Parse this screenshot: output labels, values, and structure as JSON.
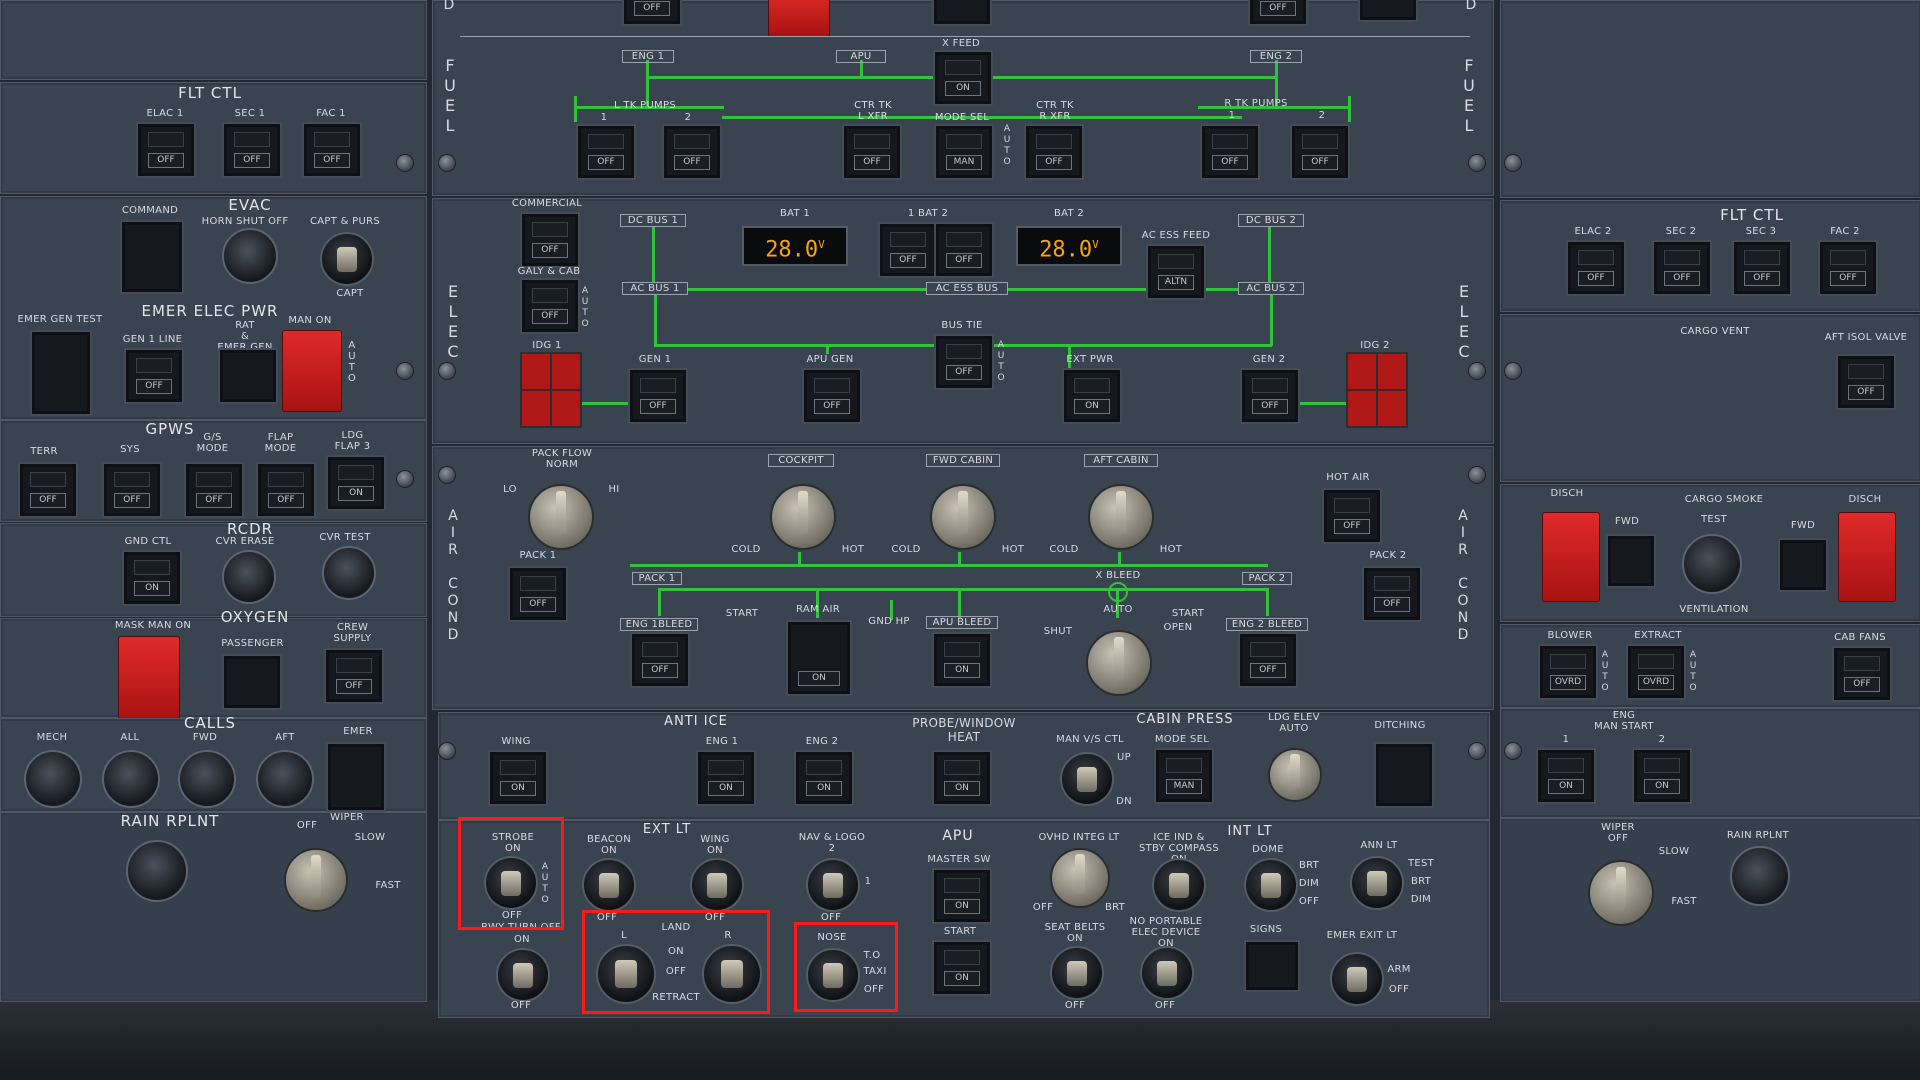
{
  "fuel": {
    "side_left": "FUEL",
    "side_right": "FUEL",
    "top_letter_left": "D",
    "top_letter_right": "D",
    "eng1": "ENG 1",
    "apu": "APU",
    "xfeed": "X FEED",
    "xfeed_ind": "ON",
    "eng2": "ENG 2",
    "l_tk_pumps": "L  TK  PUMPS",
    "r_tk_pumps": "R  TK  PUMPS",
    "ctr_tk_l": "CTR TK\nL XFR",
    "ctr_tk_r": "CTR TK\nR XFR",
    "mode_sel": "MODE SEL",
    "mode_ind": "MAN",
    "auto_vert": "AUTO",
    "off": "OFF",
    "n1": "1",
    "n2": "2"
  },
  "flt_ctl_left": {
    "title": "FLT CTL",
    "elac1": "ELAC 1",
    "sec1": "SEC 1",
    "fac1": "FAC 1"
  },
  "flt_ctl_right": {
    "title": "FLT  CTL",
    "elac2": "ELAC 2",
    "sec2": "SEC 2",
    "sec3": "SEC 3",
    "fac2": "FAC 2"
  },
  "evac": {
    "title": "EVAC",
    "command": "COMMAND",
    "horn": "HORN SHUT OFF",
    "capt_purs": "CAPT & PURS",
    "capt": "CAPT"
  },
  "emer_elec": {
    "title": "EMER ELEC PWR",
    "gen_test": "EMER GEN TEST",
    "gen1_line": "GEN 1 LINE",
    "rat": "RAT\n&\nEMER GEN",
    "man_on": "MAN ON",
    "auto": "AUTO"
  },
  "gpws": {
    "title": "GPWS",
    "terr": "TERR",
    "sys": "SYS",
    "gs_mode": "G/S\nMODE",
    "flap_mode": "FLAP\nMODE",
    "ldg_flap3": "LDG\nFLAP 3",
    "on": "ON"
  },
  "rcdr": {
    "title": "RCDR",
    "gnd_ctl": "GND CTL",
    "cvr_erase": "CVR ERASE",
    "cvr_test": "CVR TEST"
  },
  "oxygen": {
    "title": "OXYGEN",
    "mask": "MASK MAN ON",
    "passenger": "PASSENGER",
    "crew": "CREW\nSUPPLY"
  },
  "calls": {
    "title": "CALLS",
    "mech": "MECH",
    "all": "ALL",
    "fwd": "FWD",
    "aft": "AFT",
    "emer": "EMER"
  },
  "rain_left": {
    "title": "RAIN RPLNT",
    "wiper": "WIPER",
    "off": "OFF",
    "slow": "SLOW",
    "fast": "FAST"
  },
  "elec": {
    "side": "ELEC",
    "commercial": "COMMERCIAL",
    "galy": "GALY & CAB",
    "dc_bus1": "DC BUS 1",
    "dc_bus2": "DC BUS 2",
    "ac_bus1": "AC BUS 1",
    "ac_bus2": "AC BUS 2",
    "ac_ess_bus": "AC ESS BUS",
    "ac_ess_feed": "AC ESS FEED",
    "altn": "ALTN",
    "bat1": "BAT 1",
    "bat2": "BAT 2",
    "bat_center": "1   BAT   2",
    "bat1_val": "28.0",
    "bat2_val": "28.0",
    "volt_unit": "V",
    "idg1": "IDG 1",
    "idg2": "IDG 2",
    "gen1": "GEN 1",
    "gen2": "GEN 2",
    "apu_gen": "APU GEN",
    "bus_tie": "BUS TIE",
    "ext_pwr": "EXT PWR",
    "on": "ON"
  },
  "air_cond": {
    "side": "AIR COND",
    "pack_flow": "PACK FLOW\nNORM",
    "lo": "LO",
    "hi": "HI",
    "cockpit": "COCKPIT",
    "fwd_cabin": "FWD CABIN",
    "aft_cabin": "AFT  CABIN",
    "cold": "COLD",
    "hot": "HOT",
    "hot_air": "HOT AIR",
    "pack1": "PACK 1",
    "pack2": "PACK 2",
    "x_bleed": "X BLEED",
    "auto": "AUTO",
    "shut": "SHUT",
    "open": "OPEN",
    "start": "START",
    "ram_air": "RAM AIR",
    "gnd_hp": "GND HP",
    "apu_bleed": "APU  BLEED",
    "eng1_bleed": "ENG 1BLEED",
    "eng2_bleed": "ENG 2 BLEED"
  },
  "anti_ice": {
    "title": "ANTI ICE",
    "wing": "WING",
    "eng1": "ENG 1",
    "eng2": "ENG 2",
    "probe": "PROBE/WINDOW\nHEAT"
  },
  "cabin_press": {
    "title": "CABIN PRESS",
    "man_vs": "MAN V/S CTL",
    "up": "UP",
    "dn": "DN",
    "mode_sel": "MODE SEL",
    "man": "MAN",
    "ldg_elev": "LDG ELEV\nAUTO",
    "ditching": "DITCHING"
  },
  "ext_lt": {
    "title": "EXT LT",
    "strobe": "STROBE\nON",
    "beacon": "BEACON\nON",
    "wing": "WING\nON",
    "nav_logo": "NAV & LOGO\n2",
    "one": "1",
    "off": "OFF",
    "rwy_turn_off": "RWY TURN OFF",
    "on": "ON",
    "land": "LAND",
    "land_l": "L",
    "land_r": "R",
    "retract": "RETRACT",
    "nose": "NOSE",
    "to": "T.O",
    "taxi": "TAXI"
  },
  "apu_panel": {
    "title": "APU",
    "master": "MASTER SW",
    "start": "START",
    "on": "ON"
  },
  "int_lt": {
    "title": "INT LT",
    "ovhd": "OVHD INTEG LT",
    "off": "OFF",
    "brt": "BRT",
    "ice_ind": "ICE IND &\nSTBY COMPASS\nON",
    "dome": "DOME",
    "dim": "DIM",
    "ann_lt": "ANN LT",
    "test": "TEST",
    "seat_belts": "SEAT BELTS\nON",
    "no_portable": "NO PORTABLE\nELEC DEVICE\nON",
    "signs": "SIGNS",
    "emer_exit": "EMER EXIT LT",
    "arm": "ARM"
  },
  "right_panels": {
    "cargo_vent": "CARGO  VENT",
    "aft_isol": "AFT ISOL VALVE",
    "cargo_smoke": "CARGO  SMOKE",
    "disch": "DISCH",
    "fwd": "FWD",
    "test": "TEST",
    "ventilation": "VENTILATION",
    "blower": "BLOWER",
    "extract": "EXTRACT",
    "ovrd": "OVRD",
    "cab_fans": "CAB FANS",
    "eng_man_start": "ENG\nMAN START",
    "n1": "1",
    "n2": "2",
    "wiper": "WIPER\nOFF",
    "slow": "SLOW",
    "fast": "FAST",
    "rain": "RAIN RPLNT"
  },
  "colors": {
    "panel": "#3a4350",
    "green_line": "#33c23b",
    "guard_red": "#c81e1e",
    "highlight": "#ff1a1a",
    "display_amber": "#f4a414"
  }
}
